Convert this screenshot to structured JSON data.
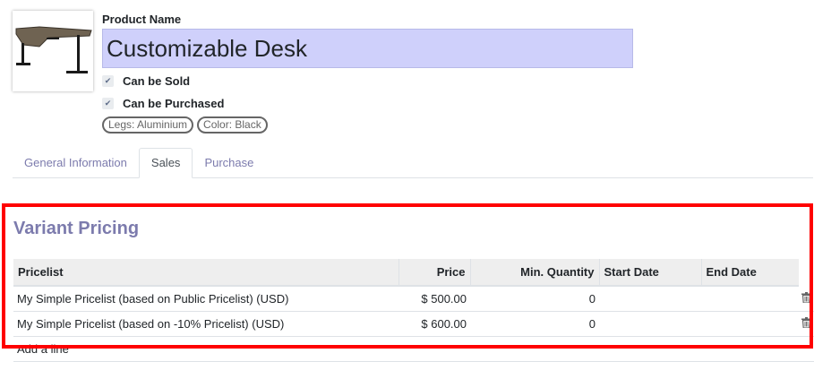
{
  "product": {
    "name_label": "Product Name",
    "name_value": "Customizable Desk",
    "image_alt": "desk-image",
    "can_be_sold_label": "Can be Sold",
    "can_be_sold": true,
    "can_be_purchased_label": "Can be Purchased",
    "can_be_purchased": true,
    "tags": [
      "Legs: Aluminium",
      "Color: Black"
    ]
  },
  "tabs": [
    {
      "label": "General Information",
      "active": false
    },
    {
      "label": "Sales",
      "active": true
    },
    {
      "label": "Purchase",
      "active": false
    }
  ],
  "variant_pricing": {
    "title": "Variant Pricing",
    "columns": {
      "pricelist": "Pricelist",
      "price": "Price",
      "min_quantity": "Min. Quantity",
      "start_date": "Start Date",
      "end_date": "End Date"
    },
    "rows": [
      {
        "pricelist": "My Simple Pricelist (based on Public Pricelist) (USD)",
        "price": "$ 500.00",
        "min_quantity": "0",
        "start_date": "",
        "end_date": ""
      },
      {
        "pricelist": "My Simple Pricelist (based on -10% Pricelist) (USD)",
        "price": "$ 600.00",
        "min_quantity": "0",
        "start_date": "",
        "end_date": ""
      }
    ],
    "add_line_label": "Add a line"
  },
  "colors": {
    "accent": "#7c7bad",
    "highlight_border": "#ff0000",
    "name_field_bg": "#cfd0fb"
  },
  "icons": {
    "check": "check-icon",
    "delete": "trash-icon"
  }
}
